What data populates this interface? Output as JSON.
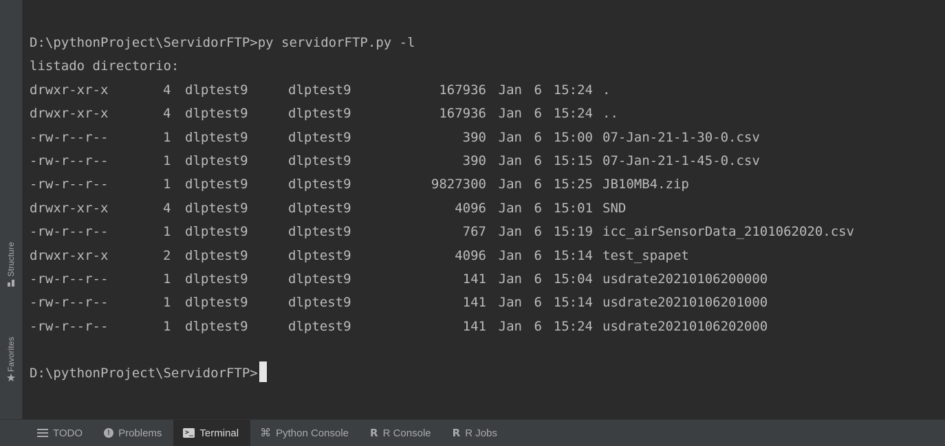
{
  "terminal": {
    "command_line": "D:\\pythonProject\\ServidorFTP>py servidorFTP.py -l",
    "listing_header": "listado directorio:",
    "entries": [
      {
        "perm": "drwxr-xr-x",
        "links": "4",
        "owner": "dlptest9",
        "group": "dlptest9",
        "size": "167936",
        "month": "Jan",
        "day": "6",
        "time": "15:24",
        "name": "."
      },
      {
        "perm": "drwxr-xr-x",
        "links": "4",
        "owner": "dlptest9",
        "group": "dlptest9",
        "size": "167936",
        "month": "Jan",
        "day": "6",
        "time": "15:24",
        "name": ".."
      },
      {
        "perm": "-rw-r--r--",
        "links": "1",
        "owner": "dlptest9",
        "group": "dlptest9",
        "size": "390",
        "month": "Jan",
        "day": "6",
        "time": "15:00",
        "name": "07-Jan-21-1-30-0.csv"
      },
      {
        "perm": "-rw-r--r--",
        "links": "1",
        "owner": "dlptest9",
        "group": "dlptest9",
        "size": "390",
        "month": "Jan",
        "day": "6",
        "time": "15:15",
        "name": "07-Jan-21-1-45-0.csv"
      },
      {
        "perm": "-rw-r--r--",
        "links": "1",
        "owner": "dlptest9",
        "group": "dlptest9",
        "size": "9827300",
        "month": "Jan",
        "day": "6",
        "time": "15:25",
        "name": "JB10MB4.zip"
      },
      {
        "perm": "drwxr-xr-x",
        "links": "4",
        "owner": "dlptest9",
        "group": "dlptest9",
        "size": "4096",
        "month": "Jan",
        "day": "6",
        "time": "15:01",
        "name": "SND"
      },
      {
        "perm": "-rw-r--r--",
        "links": "1",
        "owner": "dlptest9",
        "group": "dlptest9",
        "size": "767",
        "month": "Jan",
        "day": "6",
        "time": "15:19",
        "name": "icc_airSensorData_2101062020.csv"
      },
      {
        "perm": "drwxr-xr-x",
        "links": "2",
        "owner": "dlptest9",
        "group": "dlptest9",
        "size": "4096",
        "month": "Jan",
        "day": "6",
        "time": "15:14",
        "name": "test_spapet"
      },
      {
        "perm": "-rw-r--r--",
        "links": "1",
        "owner": "dlptest9",
        "group": "dlptest9",
        "size": "141",
        "month": "Jan",
        "day": "6",
        "time": "15:04",
        "name": "usdrate20210106200000"
      },
      {
        "perm": "-rw-r--r--",
        "links": "1",
        "owner": "dlptest9",
        "group": "dlptest9",
        "size": "141",
        "month": "Jan",
        "day": "6",
        "time": "15:14",
        "name": "usdrate20210106201000"
      },
      {
        "perm": "-rw-r--r--",
        "links": "1",
        "owner": "dlptest9",
        "group": "dlptest9",
        "size": "141",
        "month": "Jan",
        "day": "6",
        "time": "15:24",
        "name": "usdrate20210106202000"
      }
    ],
    "prompt": "D:\\pythonProject\\ServidorFTP>"
  },
  "side_tabs": {
    "structure": "Structure",
    "favorites": "Favorites"
  },
  "toolbar": {
    "tabs": [
      {
        "label": "TODO",
        "icon": "list-icon"
      },
      {
        "label": "Problems",
        "icon": "problems-icon"
      },
      {
        "label": "Terminal",
        "icon": "terminal-icon",
        "active": true
      },
      {
        "label": "Python Console",
        "icon": "python-icon"
      },
      {
        "label": "R Console",
        "icon": "r-icon"
      },
      {
        "label": "R Jobs",
        "icon": "r-icon"
      }
    ]
  },
  "colors": {
    "background": "#2b2b2b",
    "text": "#bbbbbb",
    "panel": "#3c3f41",
    "cursor": "#e6e6e6"
  }
}
